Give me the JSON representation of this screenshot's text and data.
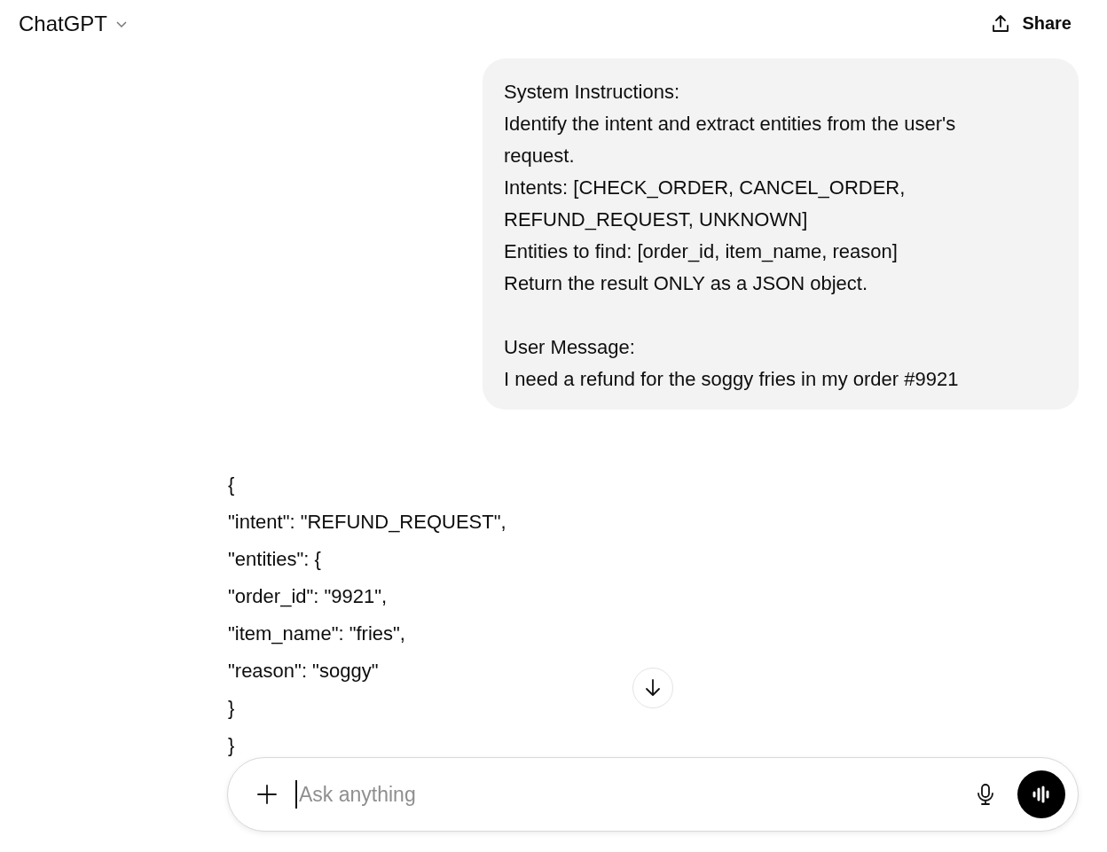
{
  "header": {
    "model": "ChatGPT",
    "share": "Share"
  },
  "user_message": {
    "paragraphs": [
      {
        "lines": [
          "System Instructions:",
          "Identify the intent and extract entities from the user's request.",
          "Intents: [CHECK_ORDER, CANCEL_ORDER, REFUND_REQUEST, UNKNOWN]",
          "Entities to find: [order_id, item_name, reason]",
          "Return the result ONLY as a JSON object."
        ]
      },
      {
        "lines": [
          "User Message:",
          "I need a refund for the soggy fries in my order #9921"
        ]
      }
    ]
  },
  "assistant_message": {
    "lines": [
      "{",
      "\"intent\": \"REFUND_REQUEST\",",
      "\"entities\": {",
      "\"order_id\": \"9921\",",
      "\"item_name\": \"fries\",",
      "\"reason\": \"soggy\"",
      "}",
      "}"
    ]
  },
  "composer": {
    "placeholder": "Ask anything"
  }
}
